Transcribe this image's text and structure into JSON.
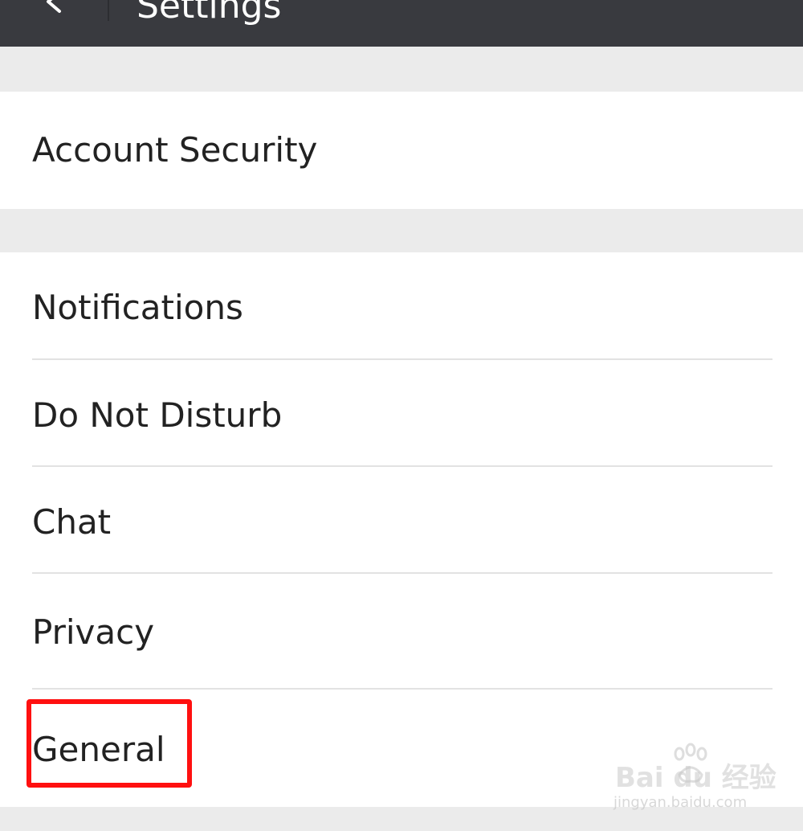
{
  "header": {
    "title": "Settings",
    "back_icon": "back-arrow-icon"
  },
  "groups": [
    {
      "items": [
        {
          "label": "Account Security"
        }
      ]
    },
    {
      "items": [
        {
          "label": "Notifications"
        },
        {
          "label": "Do Not Disturb"
        },
        {
          "label": "Chat"
        },
        {
          "label": "Privacy"
        },
        {
          "label": "General"
        }
      ]
    }
  ],
  "annotation": {
    "highlight_color": "#ff1010",
    "highlighted_item": "General"
  },
  "watermark": {
    "main": "Bai du 经验",
    "sub": "jingyan.baidu.com"
  },
  "colors": {
    "topbar": "#393a3f",
    "background": "#ebebeb",
    "row": "#ffffff"
  }
}
